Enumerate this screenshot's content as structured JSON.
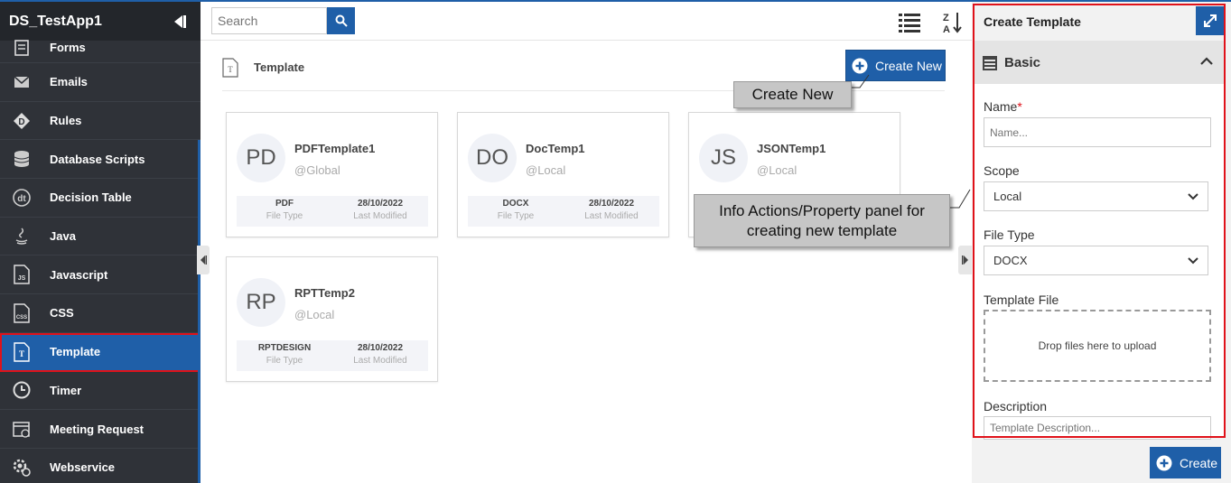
{
  "app": {
    "title": "DS_TestApp1"
  },
  "sidebar": {
    "items": [
      {
        "label": "Forms",
        "icon": "form-icon"
      },
      {
        "label": "Emails",
        "icon": "envelope-icon"
      },
      {
        "label": "Rules",
        "icon": "rules-icon"
      },
      {
        "label": "Database Scripts",
        "icon": "database-icon"
      },
      {
        "label": "Decision Table",
        "icon": "decision-table-icon"
      },
      {
        "label": "Java",
        "icon": "java-icon"
      },
      {
        "label": "Javascript",
        "icon": "javascript-file-icon"
      },
      {
        "label": "CSS",
        "icon": "css-file-icon"
      },
      {
        "label": "Template",
        "icon": "template-file-icon",
        "active": true
      },
      {
        "label": "Timer",
        "icon": "clock-icon"
      },
      {
        "label": "Meeting Request",
        "icon": "calendar-icon"
      },
      {
        "label": "Webservice",
        "icon": "gear-globe-icon"
      }
    ]
  },
  "toolbar": {
    "search_placeholder": "Search"
  },
  "main": {
    "title": "Template",
    "create_new_label": "Create New",
    "cards": [
      {
        "initials": "PD",
        "name": "PDFTemplate1",
        "scope": "@Global",
        "file_type": "PDF",
        "file_type_label": "File Type",
        "modified": "28/10/2022",
        "modified_label": "Last Modified"
      },
      {
        "initials": "DO",
        "name": "DocTemp1",
        "scope": "@Local",
        "file_type": "DOCX",
        "file_type_label": "File Type",
        "modified": "28/10/2022",
        "modified_label": "Last Modified"
      },
      {
        "initials": "JS",
        "name": "JSONTemp1",
        "scope": "@Local",
        "file_type": "",
        "file_type_label": "",
        "modified": "",
        "modified_label": ""
      },
      {
        "initials": "RP",
        "name": "RPTTemp2",
        "scope": "@Local",
        "file_type": "RPTDESIGN",
        "file_type_label": "File Type",
        "modified": "28/10/2022",
        "modified_label": "Last Modified"
      }
    ]
  },
  "callouts": {
    "create_new": "Create New",
    "info_line1": "Info Actions/Property panel for",
    "info_line2": "creating new template"
  },
  "panel": {
    "title": "Create Template",
    "section": "Basic",
    "name_label": "Name",
    "name_required_mark": "*",
    "name_placeholder": "Name...",
    "scope_label": "Scope",
    "scope_value": "Local",
    "file_type_label": "File Type",
    "file_type_value": "DOCX",
    "template_file_label": "Template File",
    "drop_text": "Drop files here to upload",
    "description_label": "Description",
    "description_placeholder": "Template Description...",
    "create_label": "Create"
  },
  "colors": {
    "accent": "#1f5fa8",
    "sidebar_bg": "#2f3238",
    "highlight_border": "#e0121a"
  }
}
